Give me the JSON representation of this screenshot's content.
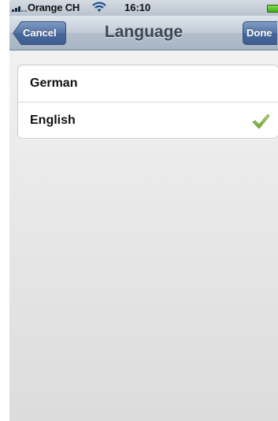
{
  "status_bar": {
    "carrier": "Orange CH",
    "time": "16:10",
    "icons": [
      "signal-icon",
      "wifi-icon",
      "battery-icon"
    ]
  },
  "navbar": {
    "title": "Language",
    "cancel_label": "Cancel",
    "done_label": "Done"
  },
  "languages": [
    {
      "label": "German",
      "selected": false
    },
    {
      "label": "English",
      "selected": true,
      "icon": "checkmark-icon"
    }
  ],
  "colors": {
    "nav_button": "#4a6a9d",
    "checkmark": "#86c33f",
    "battery": "#4bbf1c"
  }
}
